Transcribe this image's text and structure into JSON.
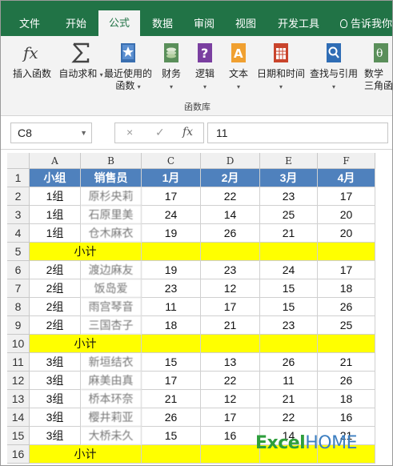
{
  "ribbon": {
    "tabs": [
      "文件",
      "开始",
      "公式",
      "数据",
      "审阅",
      "视图",
      "开发工具"
    ],
    "active_tab": "公式",
    "help": "告诉我你",
    "buttons": [
      {
        "label": "插入函数",
        "label2": "",
        "icon": "fx-icon"
      },
      {
        "label": "自动求和",
        "label2": "",
        "icon": "sigma-icon"
      },
      {
        "label": "最近使用的",
        "label2": "函数",
        "icon": "recent-book-icon"
      },
      {
        "label": "财务",
        "label2": "",
        "icon": "finance-icon"
      },
      {
        "label": "逻辑",
        "label2": "",
        "icon": "logic-icon"
      },
      {
        "label": "文本",
        "label2": "",
        "icon": "text-icon"
      },
      {
        "label": "日期和时间",
        "label2": "",
        "icon": "calendar-icon"
      },
      {
        "label": "查找与引用",
        "label2": "",
        "icon": "lookup-icon"
      },
      {
        "label": "数学",
        "label2": "三角函",
        "icon": "math-icon"
      }
    ],
    "group_label": "函数库"
  },
  "formula_bar": {
    "name_box": "C8",
    "cancel": "×",
    "enter": "✓",
    "fx": "fx",
    "value": "11"
  },
  "sheet": {
    "columns": [
      "A",
      "B",
      "C",
      "D",
      "E",
      "F"
    ],
    "rows": [
      {
        "n": "1",
        "type": "head",
        "cells": [
          "小组",
          "销售员",
          "1月",
          "2月",
          "3月",
          "4月"
        ]
      },
      {
        "n": "2",
        "type": "data",
        "cells": [
          "1组",
          "原杉央莉",
          "17",
          "22",
          "23",
          "17"
        ]
      },
      {
        "n": "3",
        "type": "data",
        "cells": [
          "1组",
          "石原里美",
          "24",
          "14",
          "25",
          "20"
        ]
      },
      {
        "n": "4",
        "type": "data",
        "cells": [
          "1组",
          "仓木麻衣",
          "19",
          "26",
          "21",
          "20"
        ]
      },
      {
        "n": "5",
        "type": "subtotal",
        "cells": [
          "小计",
          "",
          "",
          "",
          "",
          ""
        ]
      },
      {
        "n": "6",
        "type": "data",
        "cells": [
          "2组",
          "渡边麻友",
          "19",
          "23",
          "24",
          "17"
        ]
      },
      {
        "n": "7",
        "type": "data",
        "cells": [
          "2组",
          "饭岛爱",
          "23",
          "12",
          "15",
          "18"
        ]
      },
      {
        "n": "8",
        "type": "data",
        "cells": [
          "2组",
          "雨宫琴音",
          "11",
          "17",
          "15",
          "26"
        ]
      },
      {
        "n": "9",
        "type": "data",
        "cells": [
          "2组",
          "三国杏子",
          "18",
          "21",
          "23",
          "25"
        ]
      },
      {
        "n": "10",
        "type": "subtotal",
        "cells": [
          "小计",
          "",
          "",
          "",
          "",
          ""
        ]
      },
      {
        "n": "11",
        "type": "data",
        "cells": [
          "3组",
          "新垣结衣",
          "15",
          "13",
          "26",
          "21"
        ]
      },
      {
        "n": "12",
        "type": "data",
        "cells": [
          "3组",
          "麻美由真",
          "17",
          "22",
          "11",
          "26"
        ]
      },
      {
        "n": "13",
        "type": "data",
        "cells": [
          "3组",
          "桥本环奈",
          "21",
          "12",
          "21",
          "18"
        ]
      },
      {
        "n": "14",
        "type": "data",
        "cells": [
          "3组",
          "樱井莉亚",
          "26",
          "17",
          "22",
          "16"
        ]
      },
      {
        "n": "15",
        "type": "data",
        "cells": [
          "3组",
          "大桥未久",
          "15",
          "16",
          "14",
          "21"
        ]
      },
      {
        "n": "16",
        "type": "subtotal",
        "cells": [
          "小计",
          "",
          "",
          "",
          "",
          ""
        ]
      }
    ]
  },
  "watermark": {
    "part1": "Excel",
    "part2": "HOME"
  },
  "colors": {
    "ribbon_green": "#217346",
    "header_blue": "#4f81bd",
    "subtotal_yellow": "#ffff00"
  }
}
